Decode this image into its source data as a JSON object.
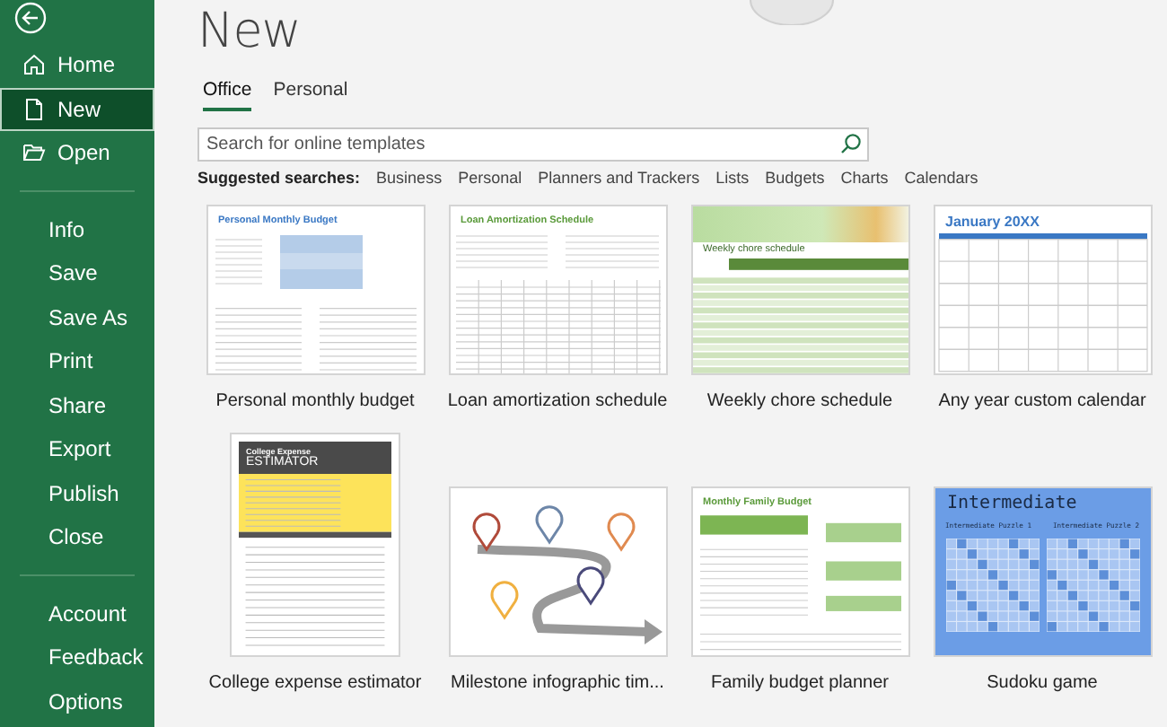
{
  "sidebar": {
    "sections": [
      [
        {
          "label": "Home",
          "kind": "home",
          "selected": false
        },
        {
          "label": "New",
          "kind": "new",
          "selected": true
        },
        {
          "label": "Open",
          "kind": "open",
          "selected": false
        }
      ],
      [
        {
          "label": "Info",
          "kind": "plain",
          "selected": false
        },
        {
          "label": "Save",
          "kind": "plain",
          "selected": false
        },
        {
          "label": "Save As",
          "kind": "plain",
          "selected": false
        },
        {
          "label": "Print",
          "kind": "plain",
          "selected": false
        },
        {
          "label": "Share",
          "kind": "plain",
          "selected": false
        },
        {
          "label": "Export",
          "kind": "plain",
          "selected": false
        },
        {
          "label": "Publish",
          "kind": "plain",
          "selected": false
        },
        {
          "label": "Close",
          "kind": "plain",
          "selected": false
        }
      ],
      [
        {
          "label": "Account",
          "kind": "plain",
          "selected": false
        },
        {
          "label": "Feedback",
          "kind": "plain",
          "selected": false
        },
        {
          "label": "Options",
          "kind": "plain",
          "selected": false
        }
      ]
    ]
  },
  "page_title": "New",
  "tabs": [
    {
      "label": "Office",
      "selected": true
    },
    {
      "label": "Personal",
      "selected": false
    }
  ],
  "search": {
    "placeholder": "Search for online templates"
  },
  "suggested": {
    "label": "Suggested searches:",
    "items": [
      "Business",
      "Personal",
      "Planners and Trackers",
      "Lists",
      "Budgets",
      "Charts",
      "Calendars"
    ]
  },
  "templates": [
    {
      "kind": "budget",
      "name": "Personal monthly budget",
      "thumb_texts": [
        "Personal Monthly Budget"
      ]
    },
    {
      "kind": "loan",
      "name": "Loan amortization schedule",
      "thumb_texts": [
        "Loan Amortization Schedule"
      ]
    },
    {
      "kind": "chore",
      "name": "Weekly chore schedule",
      "thumb_texts": [
        "Weekly chore schedule"
      ]
    },
    {
      "kind": "calendar",
      "name": "Any year custom calendar",
      "thumb_texts": [
        "January 20XX"
      ]
    },
    {
      "kind": "estimator",
      "name": "College expense estimator",
      "thumb_texts": [
        "College Expense",
        "ESTIMATOR"
      ]
    },
    {
      "kind": "milestone",
      "name": "Milestone infographic tim..."
    },
    {
      "kind": "family",
      "name": "Family budget planner",
      "thumb_texts": [
        "Monthly Family Budget"
      ]
    },
    {
      "kind": "sudoku",
      "name": "Sudoku game",
      "thumb_texts": [
        "Intermediate",
        "Intermediate Puzzle 1",
        "Intermediate Puzzle 2"
      ]
    }
  ]
}
